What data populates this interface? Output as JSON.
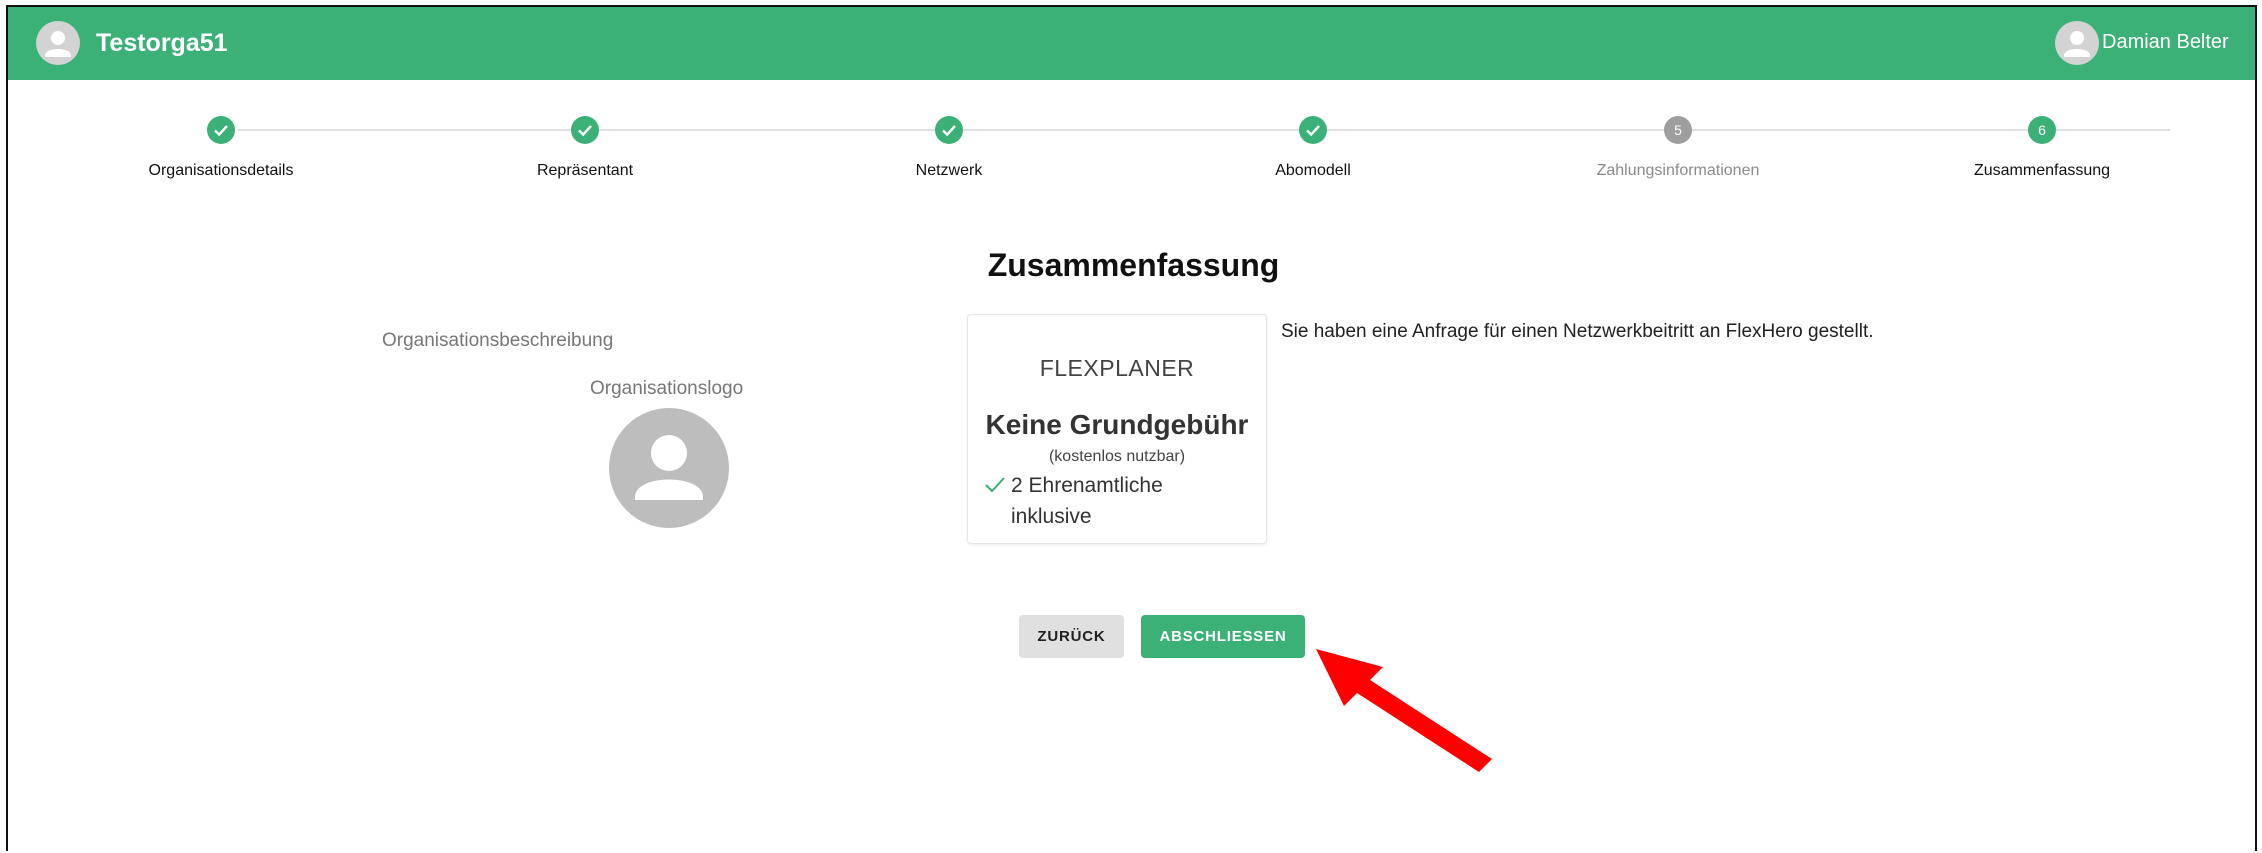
{
  "header": {
    "org_name": "Testorga51",
    "user_name": "Damian Belter",
    "color": "#3bb077"
  },
  "stepper": {
    "steps": [
      {
        "label": "Organisationsdetails",
        "state": "done"
      },
      {
        "label": "Repräsentant",
        "state": "done"
      },
      {
        "label": "Netzwerk",
        "state": "done"
      },
      {
        "label": "Abomodell",
        "state": "done"
      },
      {
        "label": "Zahlungsinformationen",
        "state": "inactive",
        "number": "5"
      },
      {
        "label": "Zusammenfassung",
        "state": "active",
        "number": "6"
      }
    ]
  },
  "main": {
    "title": "Zusammenfassung",
    "org_description_label": "Organisationsbeschreibung",
    "org_logo_label": "Organisationslogo",
    "plan": {
      "name": "FLEXPLANER",
      "price": "Keine Grundgebühr",
      "subtitle": "(kostenlos nutzbar)",
      "feature": "2 Ehrenamtliche inklusive"
    },
    "info_text": "Sie haben eine Anfrage für einen Netzwerkbeitritt an FlexHero gestellt."
  },
  "actions": {
    "back_label": "ZURÜCK",
    "finish_label": "ABSCHLIESSEN"
  },
  "icons": {
    "org_avatar": "person-icon",
    "user_avatar": "person-icon",
    "check": "check-icon",
    "annotation": "red-arrow"
  }
}
